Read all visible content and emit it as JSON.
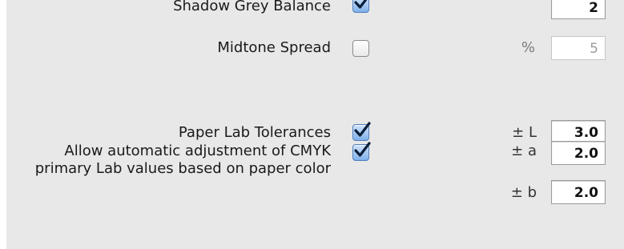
{
  "rows": {
    "shadow_grey_balance": {
      "label": "Shadow Grey Balance",
      "checked": true,
      "value": "2"
    },
    "midtone_spread": {
      "label": "Midtone Spread",
      "checked": false,
      "unit": "%",
      "value": "5"
    },
    "paper_lab_tolerances": {
      "label": "Paper Lab Tolerances",
      "checked": true,
      "unit": "± L",
      "value": "3.0"
    },
    "auto_adjust": {
      "label": "Allow automatic adjustment of CMYK primary Lab values based on paper color",
      "checked": true,
      "a_unit": "± a",
      "a_value": "2.0",
      "b_unit": "± b",
      "b_value": "2.0"
    }
  },
  "colors": {
    "panel_background": "#e8e8e8",
    "checkbox_accent": "#4f7bb8"
  }
}
